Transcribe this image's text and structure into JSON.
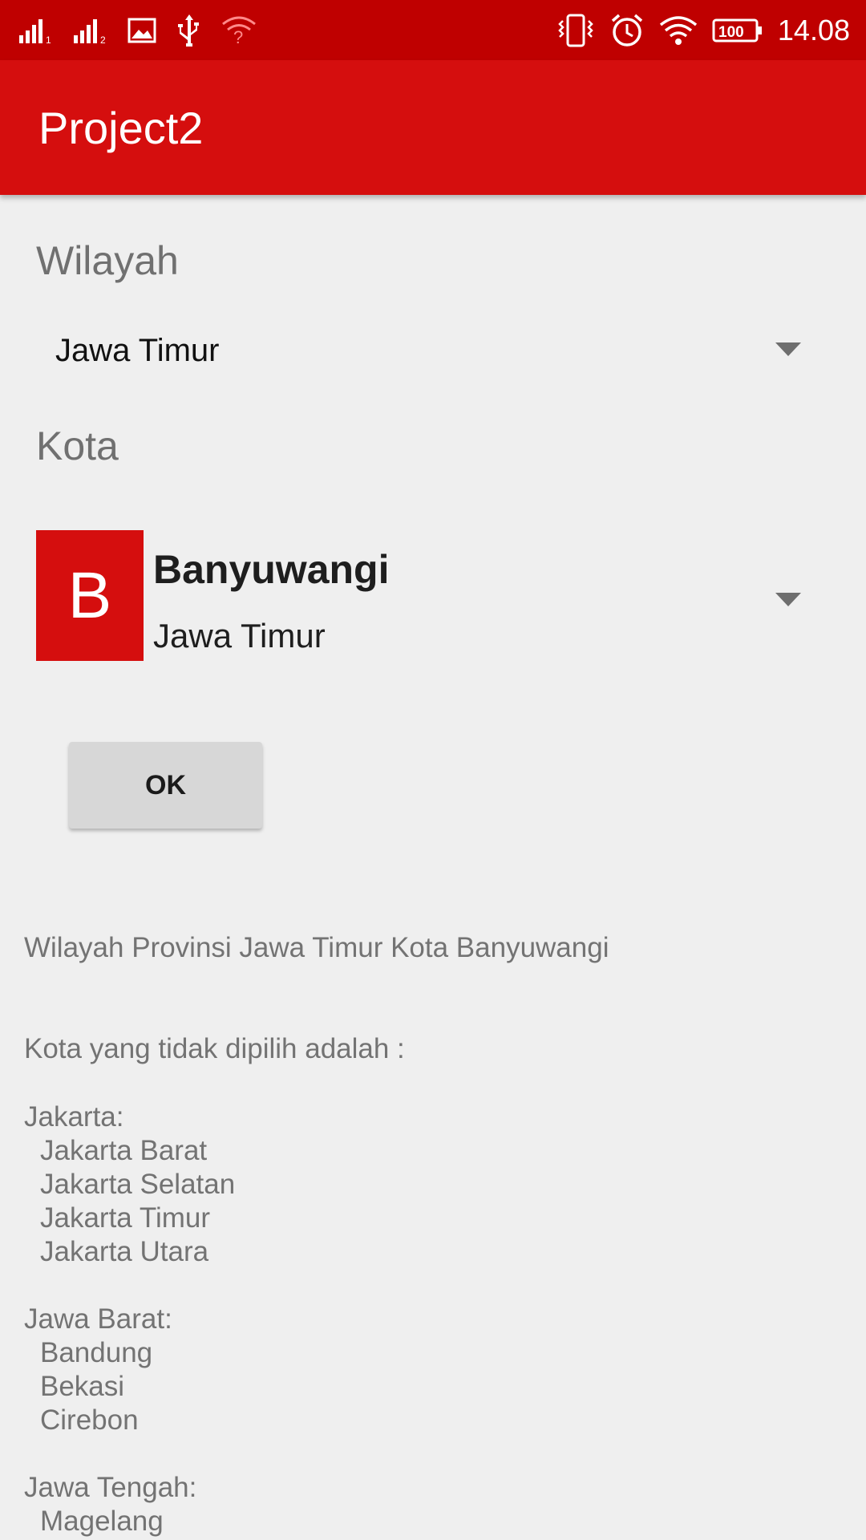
{
  "status_bar": {
    "time": "14.08",
    "battery": "100",
    "colors": {
      "background": "#bf0000"
    },
    "icons": [
      "signal-1-icon",
      "signal-2-icon",
      "gallery-icon",
      "usb-icon",
      "wifi-unknown-icon",
      "vibrate-icon",
      "alarm-icon",
      "wifi-icon",
      "battery-icon"
    ]
  },
  "app_bar": {
    "title": "Project2",
    "color": "#d50e0e"
  },
  "form": {
    "wilayah_label": "Wilayah",
    "wilayah_selected": "Jawa Timur",
    "kota_label": "Kota",
    "kota_selected": {
      "initial": "B",
      "name": "Banyuwangi",
      "province": "Jawa Timur"
    },
    "ok_label": "OK"
  },
  "result": {
    "text": "Wilayah Provinsi Jawa Timur Kota Banyuwangi",
    "other_heading": "Kota yang tidak dipilih adalah :",
    "groups": [
      {
        "name": "Jakarta:",
        "cities": [
          "Jakarta Barat",
          "Jakarta Selatan",
          "Jakarta Timur",
          "Jakarta Utara"
        ]
      },
      {
        "name": "Jawa Barat:",
        "cities": [
          "Bandung",
          "Bekasi",
          "Cirebon"
        ]
      },
      {
        "name": "Jawa Tengah:",
        "cities": [
          "Magelang"
        ]
      }
    ]
  }
}
